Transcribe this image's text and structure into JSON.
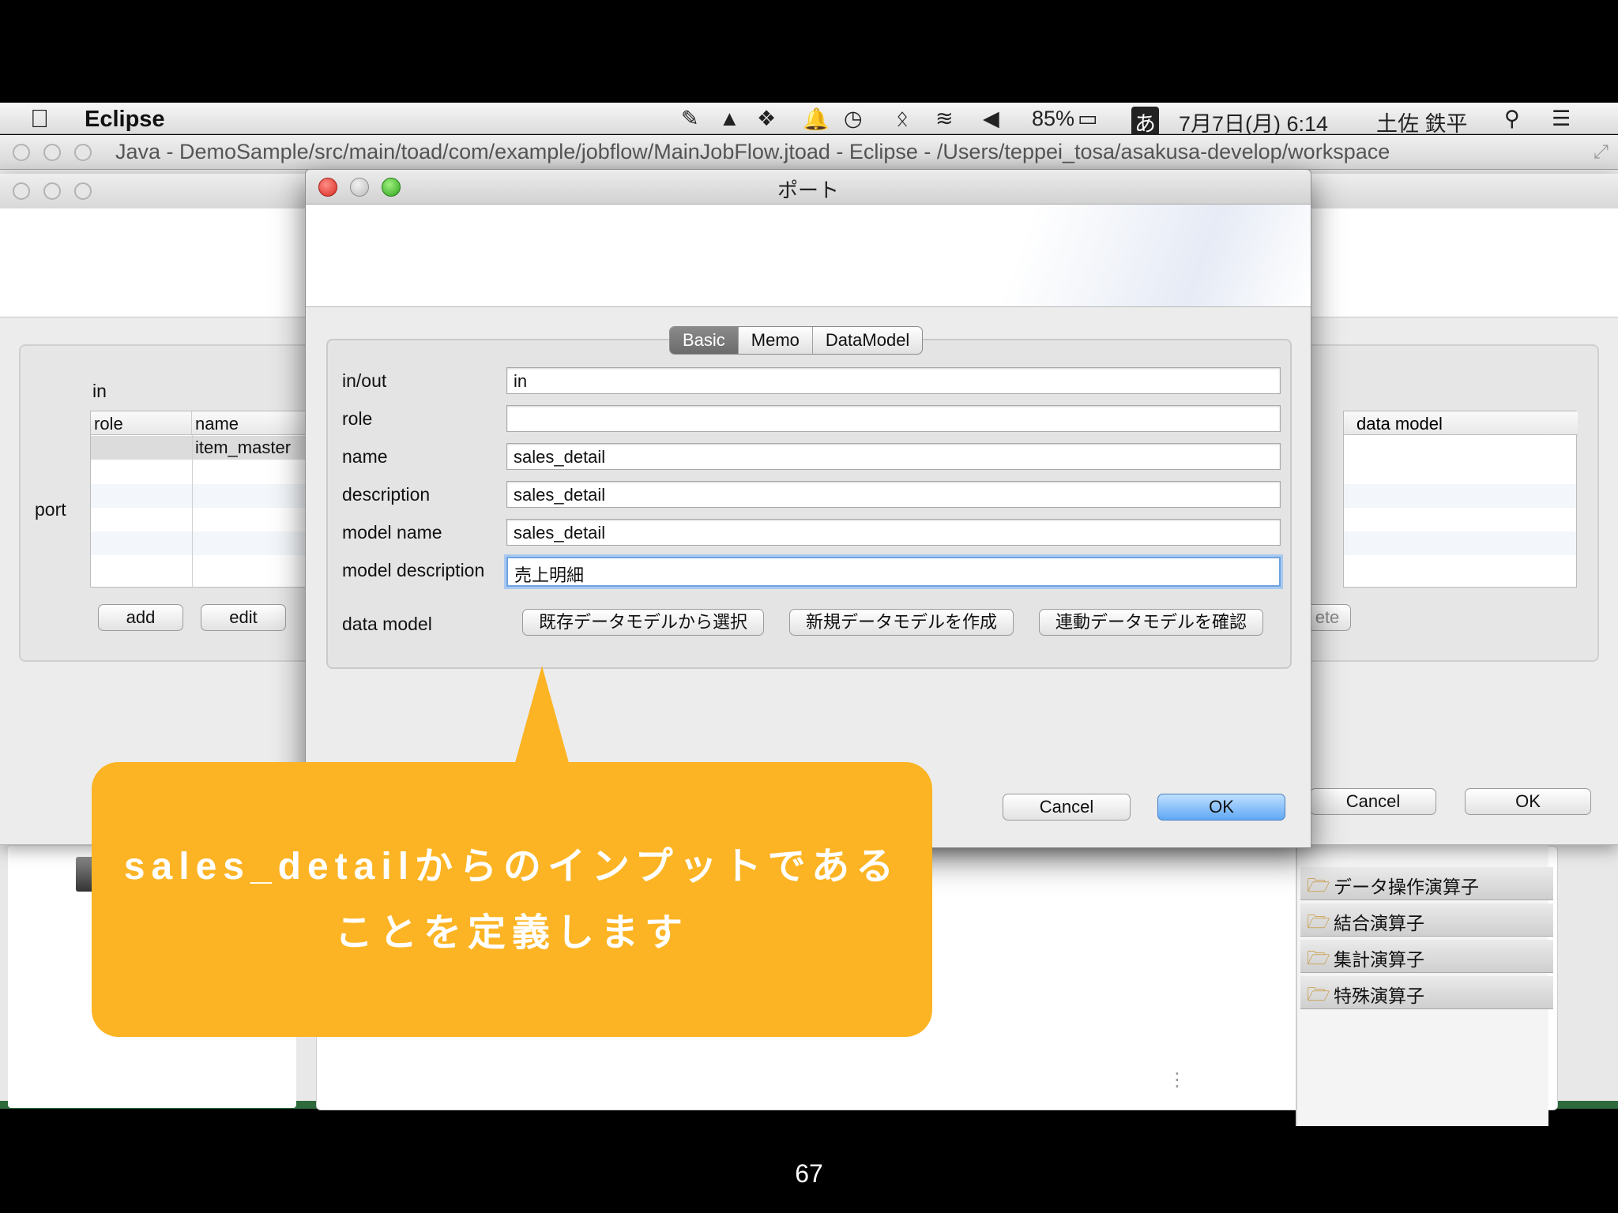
{
  "menubar": {
    "app_name": "Eclipse",
    "battery": "85%",
    "input_method": "あ",
    "datetime": "7月7日(月) 6:14",
    "user": "土佐 鉄平"
  },
  "eclipse_window": {
    "title": "Java - DemoSample/src/main/toad/com/example/jobflow/MainJobFlow.jtoad - Eclipse - /Users/teppei_tosa/asakusa-develop/workspace"
  },
  "background_dialog": {
    "section_label": "in",
    "port_label": "port",
    "table_headers": [
      "role",
      "name"
    ],
    "table_row": [
      "",
      "item_master"
    ],
    "right_table_header": "data model",
    "add_label": "add",
    "edit_label": "edit",
    "delete_partial": "ete",
    "cancel_label": "Cancel",
    "ok_label": "OK"
  },
  "dialog": {
    "title": "ポート",
    "tabs": [
      "Basic",
      "Memo",
      "DataModel"
    ],
    "active_tab": "Basic",
    "fields": [
      {
        "label": "in/out",
        "value": "in"
      },
      {
        "label": "role",
        "value": ""
      },
      {
        "label": "name",
        "value": "sales_detail"
      },
      {
        "label": "description",
        "value": "sales_detail"
      },
      {
        "label": "model name",
        "value": "sales_detail"
      },
      {
        "label": "model description",
        "value": "売上明細"
      }
    ],
    "data_model_label": "data model",
    "data_model_buttons": [
      "既存データモデルから選択",
      "新規データモデルを作成",
      "連動データモデルを確認"
    ],
    "cancel_label": "Cancel",
    "ok_label": "OK"
  },
  "palette": {
    "items": [
      "データ操作演算子",
      "結合演算子",
      "集計演算子",
      "特殊演算子"
    ]
  },
  "callout": {
    "line1": "sales_detailからのインプットである",
    "line2": "ことを定義します"
  },
  "page_number": "67",
  "colors": {
    "callout": "#fcb424",
    "primary_button": "#5fa8f5",
    "close_light": "#d62b22",
    "zoom_light": "#2fa31c"
  }
}
